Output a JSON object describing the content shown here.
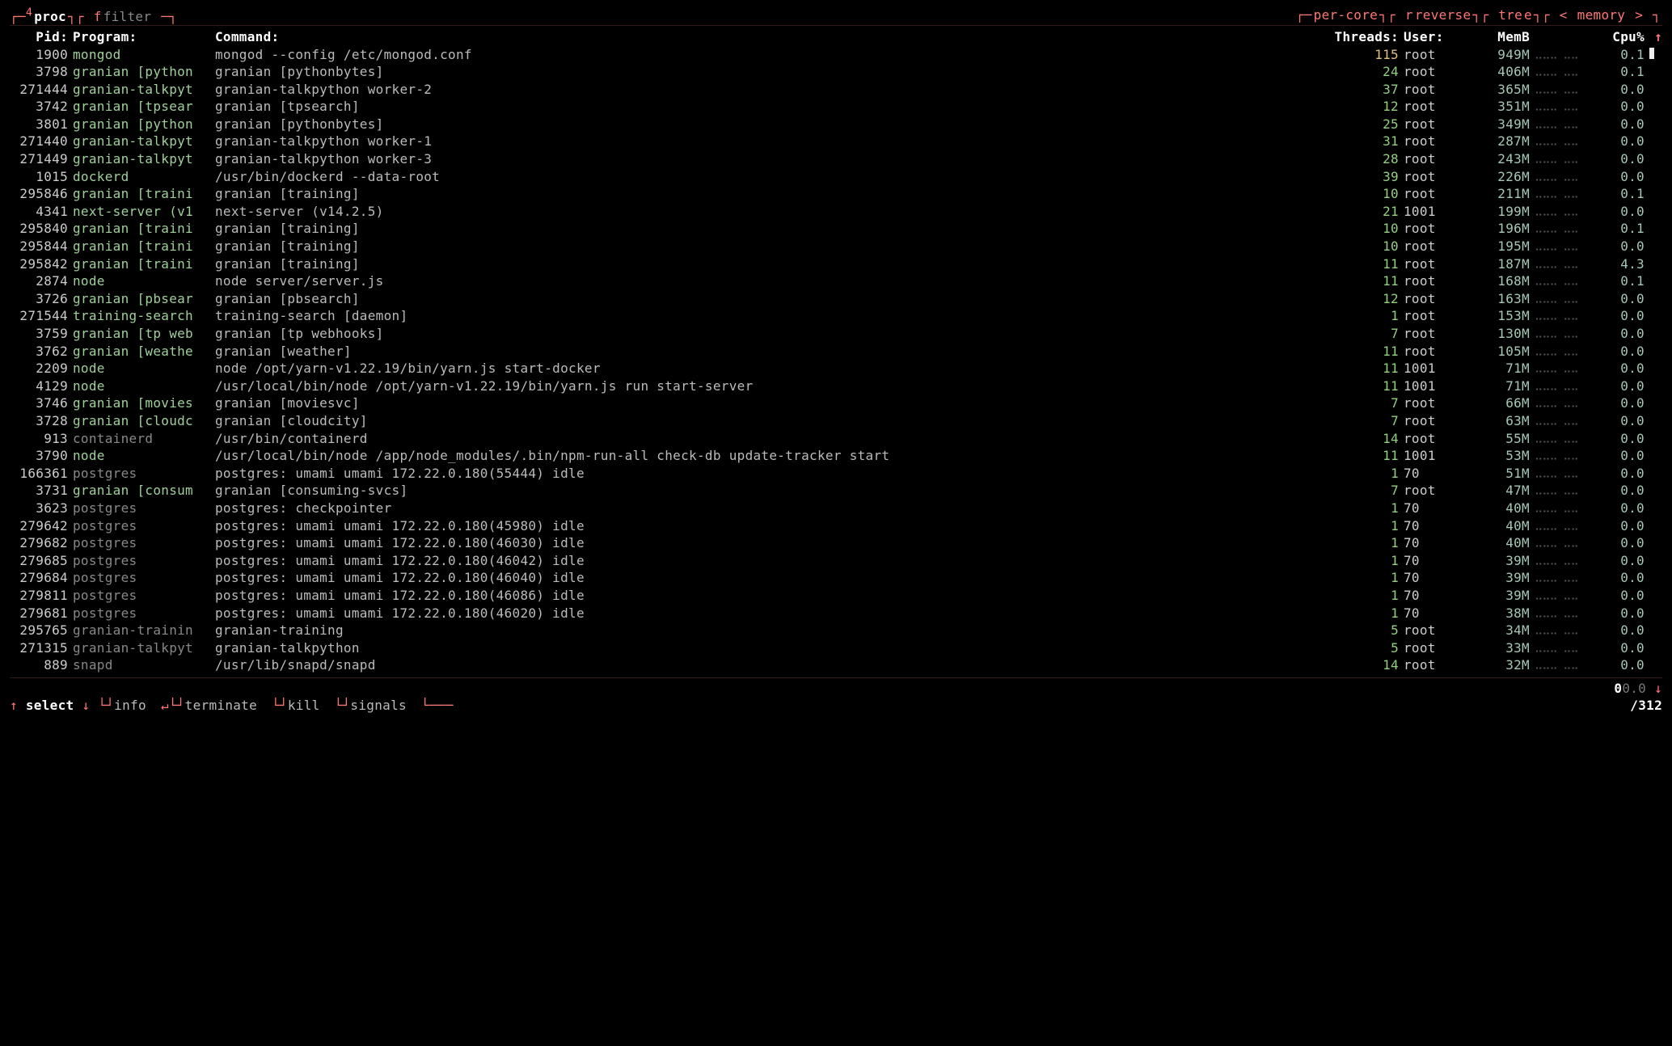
{
  "top": {
    "proc": "proc",
    "filter": "filter",
    "per_core": "per-core",
    "reverse": "reverse",
    "tree": "tree",
    "sort_left": "<",
    "sort_mem": "memory",
    "sort_right": ">"
  },
  "headers": {
    "pid": "Pid:",
    "program": "Program:",
    "command": "Command:",
    "threads": "Threads:",
    "user": "User:",
    "mem": "MemB",
    "cpu": "Cpu%"
  },
  "rows": [
    {
      "pid": "1900",
      "program": "mongod",
      "command": "mongod --config /etc/mongod.conf",
      "threads": "115",
      "threads_alt": true,
      "user": "root",
      "mem": "949M",
      "cpu": "0.1",
      "scroll": true
    },
    {
      "pid": "3798",
      "program": "granian [python",
      "command": "granian [pythonbytes]",
      "threads": "24",
      "user": "root",
      "mem": "406M",
      "cpu": "0.1"
    },
    {
      "pid": "271444",
      "program": "granian-talkpyt",
      "command": "granian-talkpython worker-2",
      "threads": "37",
      "user": "root",
      "mem": "365M",
      "cpu": "0.0"
    },
    {
      "pid": "3742",
      "program": "granian [tpsear",
      "command": "granian [tpsearch]",
      "threads": "12",
      "user": "root",
      "mem": "351M",
      "cpu": "0.0"
    },
    {
      "pid": "3801",
      "program": "granian [python",
      "command": "granian [pythonbytes]",
      "threads": "25",
      "user": "root",
      "mem": "349M",
      "cpu": "0.0"
    },
    {
      "pid": "271440",
      "program": "granian-talkpyt",
      "command": "granian-talkpython worker-1",
      "threads": "31",
      "user": "root",
      "mem": "287M",
      "cpu": "0.0"
    },
    {
      "pid": "271449",
      "program": "granian-talkpyt",
      "command": "granian-talkpython worker-3",
      "threads": "28",
      "user": "root",
      "mem": "243M",
      "cpu": "0.0"
    },
    {
      "pid": "1015",
      "program": "dockerd",
      "command": "/usr/bin/dockerd --data-root",
      "threads": "39",
      "user": "root",
      "mem": "226M",
      "cpu": "0.0"
    },
    {
      "pid": "295846",
      "program": "granian [traini",
      "command": "granian [training]",
      "threads": "10",
      "user": "root",
      "mem": "211M",
      "cpu": "0.1"
    },
    {
      "pid": "4341",
      "program": "next-server (v1",
      "command": "next-server (v14.2.5)",
      "threads": "21",
      "user": "1001",
      "mem": "199M",
      "cpu": "0.0"
    },
    {
      "pid": "295840",
      "program": "granian [traini",
      "command": "granian [training]",
      "threads": "10",
      "user": "root",
      "mem": "196M",
      "cpu": "0.1"
    },
    {
      "pid": "295844",
      "program": "granian [traini",
      "command": "granian [training]",
      "threads": "10",
      "user": "root",
      "mem": "195M",
      "cpu": "0.0"
    },
    {
      "pid": "295842",
      "program": "granian [traini",
      "command": "granian [training]",
      "threads": "11",
      "user": "root",
      "mem": "187M",
      "cpu": "4.3"
    },
    {
      "pid": "2874",
      "program": "node",
      "command": "node server/server.js",
      "threads": "11",
      "user": "root",
      "mem": "168M",
      "cpu": "0.1"
    },
    {
      "pid": "3726",
      "program": "granian [pbsear",
      "command": "granian [pbsearch]",
      "threads": "12",
      "user": "root",
      "mem": "163M",
      "cpu": "0.0"
    },
    {
      "pid": "271544",
      "program": "training-search",
      "command": "training-search [daemon]",
      "threads": "1",
      "user": "root",
      "mem": "153M",
      "cpu": "0.0"
    },
    {
      "pid": "3759",
      "program": "granian [tp web",
      "command": "granian [tp webhooks]",
      "threads": "7",
      "user": "root",
      "mem": "130M",
      "cpu": "0.0"
    },
    {
      "pid": "3762",
      "program": "granian [weathe",
      "command": "granian [weather]",
      "threads": "11",
      "user": "root",
      "mem": "105M",
      "cpu": "0.0"
    },
    {
      "pid": "2209",
      "program": "node",
      "command": "node /opt/yarn-v1.22.19/bin/yarn.js start-docker",
      "threads": "11",
      "user": "1001",
      "mem": "71M",
      "cpu": "0.0"
    },
    {
      "pid": "4129",
      "program": "node",
      "command": "/usr/local/bin/node /opt/yarn-v1.22.19/bin/yarn.js run start-server",
      "threads": "11",
      "user": "1001",
      "mem": "71M",
      "cpu": "0.0"
    },
    {
      "pid": "3746",
      "program": "granian [movies",
      "command": "granian [moviesvc]",
      "threads": "7",
      "user": "root",
      "mem": "66M",
      "cpu": "0.0"
    },
    {
      "pid": "3728",
      "program": "granian [cloudc",
      "command": "granian [cloudcity]",
      "threads": "7",
      "user": "root",
      "mem": "63M",
      "cpu": "0.0"
    },
    {
      "pid": "913",
      "program": "containerd",
      "gray": true,
      "command": "/usr/bin/containerd",
      "threads": "14",
      "user": "root",
      "mem": "55M",
      "cpu": "0.0"
    },
    {
      "pid": "3790",
      "program": "node",
      "command": "/usr/local/bin/node /app/node_modules/.bin/npm-run-all check-db update-tracker start",
      "threads": "11",
      "user": "1001",
      "mem": "53M",
      "cpu": "0.0"
    },
    {
      "pid": "166361",
      "program": "postgres",
      "gray": true,
      "command": "postgres: umami umami 172.22.0.180(55444) idle",
      "threads": "1",
      "user": "70",
      "mem": "51M",
      "cpu": "0.0"
    },
    {
      "pid": "3731",
      "program": "granian [consum",
      "command": "granian [consuming-svcs]",
      "threads": "7",
      "user": "root",
      "mem": "47M",
      "cpu": "0.0"
    },
    {
      "pid": "3623",
      "program": "postgres",
      "gray": true,
      "command": "postgres: checkpointer",
      "threads": "1",
      "user": "70",
      "mem": "40M",
      "cpu": "0.0"
    },
    {
      "pid": "279642",
      "program": "postgres",
      "gray": true,
      "command": "postgres: umami umami 172.22.0.180(45980) idle",
      "threads": "1",
      "user": "70",
      "mem": "40M",
      "cpu": "0.0"
    },
    {
      "pid": "279682",
      "program": "postgres",
      "gray": true,
      "command": "postgres: umami umami 172.22.0.180(46030) idle",
      "threads": "1",
      "user": "70",
      "mem": "40M",
      "cpu": "0.0"
    },
    {
      "pid": "279685",
      "program": "postgres",
      "gray": true,
      "command": "postgres: umami umami 172.22.0.180(46042) idle",
      "threads": "1",
      "user": "70",
      "mem": "39M",
      "cpu": "0.0"
    },
    {
      "pid": "279684",
      "program": "postgres",
      "gray": true,
      "command": "postgres: umami umami 172.22.0.180(46040) idle",
      "threads": "1",
      "user": "70",
      "mem": "39M",
      "cpu": "0.0"
    },
    {
      "pid": "279811",
      "program": "postgres",
      "gray": true,
      "command": "postgres: umami umami 172.22.0.180(46086) idle",
      "threads": "1",
      "user": "70",
      "mem": "39M",
      "cpu": "0.0"
    },
    {
      "pid": "279681",
      "program": "postgres",
      "gray": true,
      "command": "postgres: umami umami 172.22.0.180(46020) idle",
      "threads": "1",
      "user": "70",
      "mem": "38M",
      "cpu": "0.0"
    },
    {
      "pid": "295765",
      "program": "granian-trainin",
      "gray": true,
      "command": "granian-training",
      "threads": "5",
      "user": "root",
      "mem": "34M",
      "cpu": "0.0"
    },
    {
      "pid": "271315",
      "program": "granian-talkpyt",
      "gray": true,
      "command": "granian-talkpython",
      "threads": "5",
      "user": "root",
      "mem": "33M",
      "cpu": "0.0"
    },
    {
      "pid": "889",
      "program": "snapd",
      "gray": true,
      "command": "/usr/lib/snapd/snapd",
      "threads": "14",
      "user": "root",
      "mem": "32M",
      "cpu": "0.0"
    }
  ],
  "bottom": {
    "select": "select",
    "info": "info",
    "terminate": "terminate",
    "kill": "kill",
    "signals": "signals",
    "pos": "0",
    "pct": "0.0",
    "total": "/312"
  },
  "spark": "⣀⣀⣀ ⣀⣀"
}
